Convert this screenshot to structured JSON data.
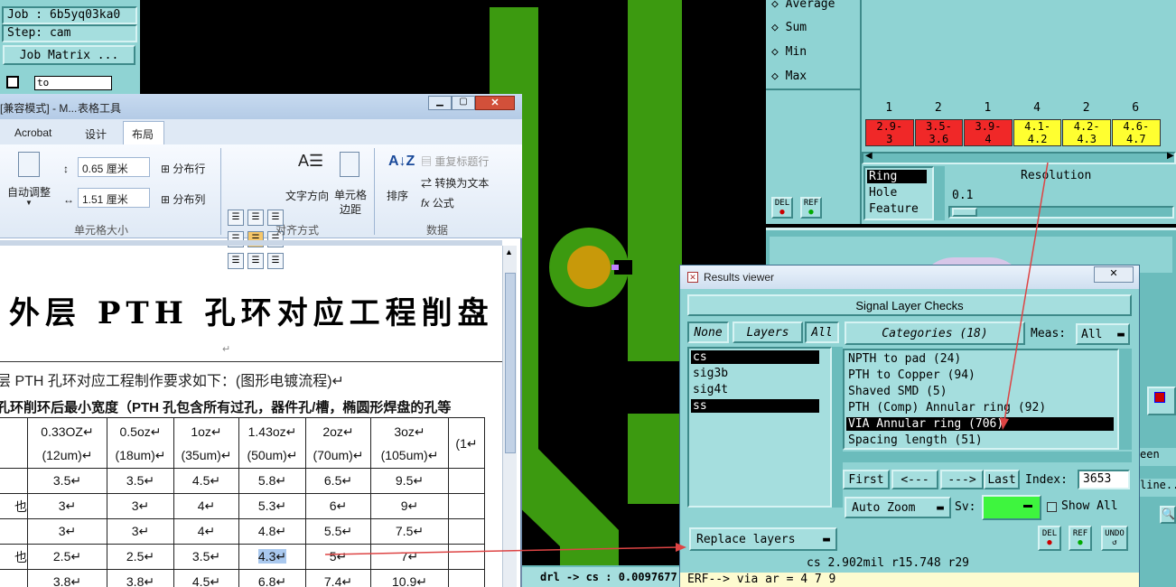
{
  "job_panel": {
    "job": "Job : 6b5yq03ka0",
    "step": "Step: cam",
    "matrix_button": "Job Matrix ...",
    "to_field": "to"
  },
  "stats_panel": {
    "options": [
      "Average",
      "Sum",
      "Min",
      "Max"
    ],
    "del": "DEL",
    "ref": "REF"
  },
  "histogram": {
    "counts": [
      "1",
      "2",
      "1",
      "4",
      "2",
      "6"
    ],
    "bins": [
      {
        "label": "2.9-\n3",
        "color": "#f02828"
      },
      {
        "label": "3.5-\n3.6",
        "color": "#f02828"
      },
      {
        "label": "3.9-\n4",
        "color": "#f02828"
      },
      {
        "label": "4.1-\n4.2",
        "color": "#ffff30"
      },
      {
        "label": "4.2-\n4.3",
        "color": "#ffff30"
      },
      {
        "label": "4.6-\n4.7",
        "color": "#ffff30"
      }
    ],
    "modes": [
      "Ring",
      "Hole",
      "Feature"
    ],
    "resolution_label": "Resolution",
    "resolution_value": "0.1"
  },
  "word": {
    "title_left": "[兼容模式] - M...",
    "title_tools": "表格工具",
    "tabs": [
      "Acrobat",
      "设计",
      "布局"
    ],
    "auto_fit": "自动调整",
    "height_value": "0.65 厘米",
    "width_value": "1.51 厘米",
    "dist_rows": "分布行",
    "dist_cols": "分布列",
    "group_cell_size": "单元格大小",
    "text_direction": "文字方向",
    "cell_margin": "单元格\n边距",
    "group_align": "对齐方式",
    "sort": "排序",
    "repeat_header": "重复标题行",
    "convert_text": "转换为文本",
    "formula": "公式",
    "group_data": "数据",
    "heading": "外层 PTH 孔环对应工程削盘",
    "paragraph1": "层 PTH 孔环对应工程制作要求如下：(图形电镀流程)↵",
    "paragraph2": "孔环削环后最小宽度（PTH 孔包含所有过孔，器件孔/槽，椭圆形焊盘的孔等",
    "table_header": [
      [
        "0.33OZ↵",
        "(12um)↵"
      ],
      [
        "0.5oz↵",
        "(18um)↵"
      ],
      [
        "1oz↵",
        "(35um)↵"
      ],
      [
        "1.43oz↵",
        "(50um)↵"
      ],
      [
        "2oz↵",
        "(70um)↵"
      ],
      [
        "3oz↵",
        "(105um)↵"
      ],
      [
        "",
        "(1↵"
      ]
    ],
    "table_rows": [
      {
        "lead": "",
        "cells": [
          "3.5↵",
          "3.5↵",
          "4.5↵",
          "5.8↵",
          "6.5↵",
          "9.5↵"
        ]
      },
      {
        "lead": "也",
        "cells": [
          "3↵",
          "3↵",
          "4↵",
          "5.3↵",
          "6↵",
          "9↵"
        ]
      },
      {
        "lead": "",
        "cells": [
          "3↵",
          "3↵",
          "4↵",
          "4.8↵",
          "5.5↵",
          "7.5↵"
        ]
      },
      {
        "lead": "也",
        "cells": [
          "2.5↵",
          "2.5↵",
          "3.5↵",
          "4.3↵",
          "5↵",
          "7↵"
        ]
      },
      {
        "lead": "",
        "cells": [
          "3.8↵",
          "3.8↵",
          "4.5↵",
          "6.8↵",
          "7.4↵",
          "10.9↵"
        ]
      }
    ]
  },
  "results": {
    "title": "Results viewer",
    "header": "Signal Layer Checks",
    "none_btn": "None",
    "layers_btn": "Layers",
    "all_btn": "All",
    "layers": [
      "cs",
      "sig3b",
      "sig4t",
      "ss"
    ],
    "categories_btn": "Categories (18)",
    "meas_label": "Meas:",
    "meas_value": "All",
    "categories": [
      "NPTH to pad (24)",
      "PTH to Copper (94)",
      "Shaved SMD (5)",
      "PTH (Comp) Annular ring (92)",
      "VIA Annular ring (706)",
      "Spacing length (51)"
    ],
    "first": "First",
    "prev": "<---",
    "next": "--->",
    "last": "Last",
    "index_label": "Index:",
    "index_value": "3653",
    "auto_zoom": "Auto Zoom",
    "sv_label": "Sv:",
    "show_all": "Show All",
    "replace_layers": "Replace layers",
    "del": "DEL",
    "ref": "REF",
    "undo": "UNDO",
    "status": "cs 2.902mil  r15.748  r29",
    "erf": "ERF--> via ar = 4 7 9"
  },
  "drl_status": "drl -> cs : 0.0097677",
  "right_edge": {
    "seen": "een",
    "line": "line..."
  }
}
